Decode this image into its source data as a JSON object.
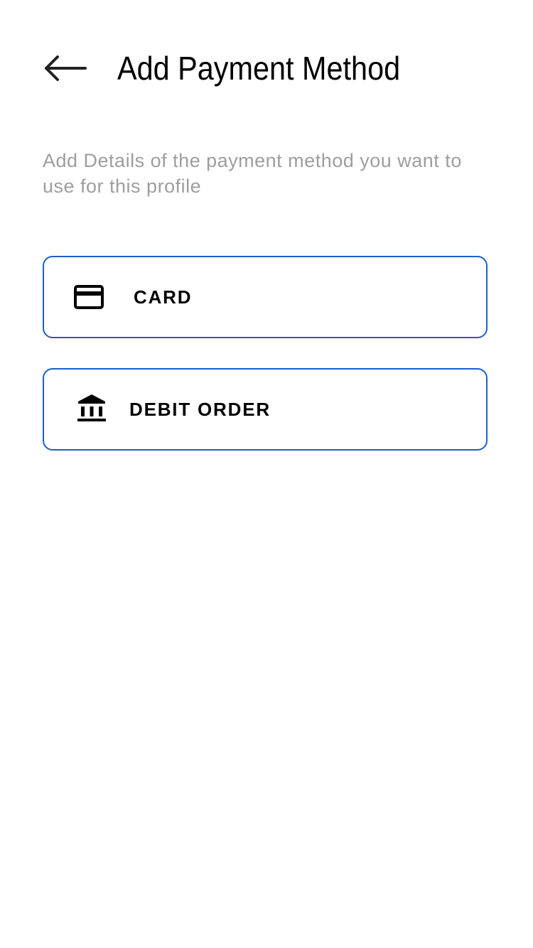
{
  "header": {
    "back_icon": "arrow-left-icon",
    "title": "Add Payment Method"
  },
  "main": {
    "subtitle": "Add Details of the payment method you want to use for this profile",
    "options": [
      {
        "label": "CARD",
        "icon": "credit-card-icon"
      },
      {
        "label": "DEBIT ORDER",
        "icon": "bank-icon"
      }
    ]
  },
  "colors": {
    "background": "#ffffff",
    "accent_border": "#1f5fc8",
    "subtitle_text": "#9e9e9e",
    "primary_text": "#000000"
  }
}
